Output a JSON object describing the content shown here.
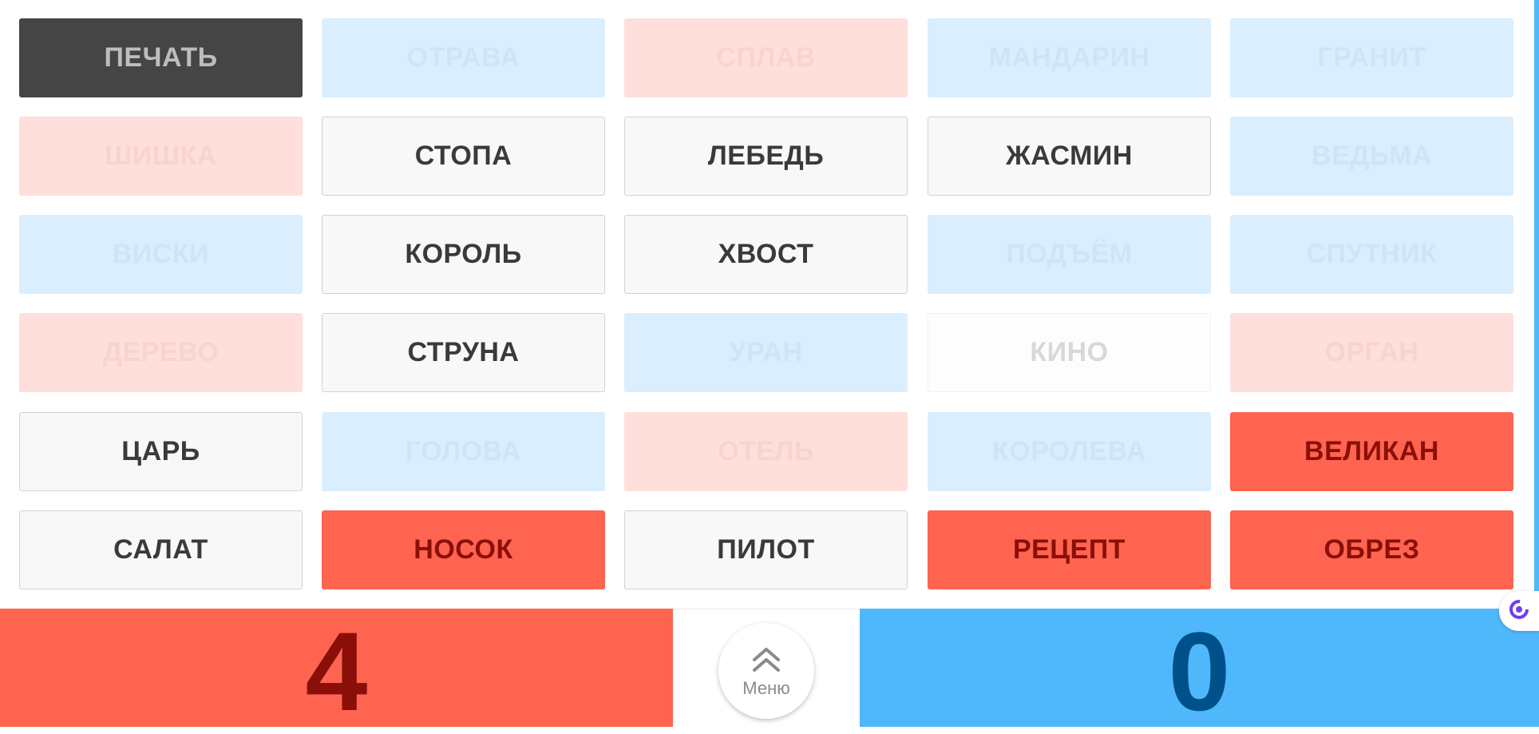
{
  "board": {
    "rows": [
      [
        {
          "word": "ПЕЧАТЬ",
          "state": "black-open"
        },
        {
          "word": "ОТРАВА",
          "state": "blue-faded"
        },
        {
          "word": "СПЛАВ",
          "state": "red-faded"
        },
        {
          "word": "МАНДАРИН",
          "state": "blue-faded"
        },
        {
          "word": "ГРАНИТ",
          "state": "blue-faded"
        }
      ],
      [
        {
          "word": "ШИШКА",
          "state": "red-faded"
        },
        {
          "word": "СТОПА",
          "state": "neutral"
        },
        {
          "word": "ЛЕБЕДЬ",
          "state": "neutral"
        },
        {
          "word": "ЖАСМИН",
          "state": "neutral"
        },
        {
          "word": "ВЕДЬМА",
          "state": "blue-faded"
        }
      ],
      [
        {
          "word": "ВИСКИ",
          "state": "blue-faded"
        },
        {
          "word": "КОРОЛЬ",
          "state": "neutral"
        },
        {
          "word": "ХВОСТ",
          "state": "neutral"
        },
        {
          "word": "ПОДЪЁМ",
          "state": "blue-faded"
        },
        {
          "word": "СПУТНИК",
          "state": "blue-faded"
        }
      ],
      [
        {
          "word": "ДЕРЕВО",
          "state": "red-faded"
        },
        {
          "word": "СТРУНА",
          "state": "neutral"
        },
        {
          "word": "УРАН",
          "state": "blue-faded"
        },
        {
          "word": "КИНО",
          "state": "neutral-faded"
        },
        {
          "word": "ОРГАН",
          "state": "red-faded"
        }
      ],
      [
        {
          "word": "ЦАРЬ",
          "state": "neutral"
        },
        {
          "word": "ГОЛОВА",
          "state": "blue-faded"
        },
        {
          "word": "ОТЕЛЬ",
          "state": "red-faded"
        },
        {
          "word": "КОРОЛЕВА",
          "state": "blue-faded"
        },
        {
          "word": "ВЕЛИКАН",
          "state": "red-open"
        }
      ],
      [
        {
          "word": "САЛАТ",
          "state": "neutral"
        },
        {
          "word": "НОСОК",
          "state": "red-open"
        },
        {
          "word": "ПИЛОТ",
          "state": "neutral"
        },
        {
          "word": "РЕЦЕПТ",
          "state": "red-open"
        },
        {
          "word": "ОБРЕЗ",
          "state": "red-open"
        }
      ]
    ]
  },
  "scores": {
    "red": "4",
    "blue": "0"
  },
  "menu": {
    "label": "Меню",
    "icon": "double-chevron-up-icon"
  },
  "colors": {
    "red_team": "#fe6450",
    "blue_team": "#4fb8fb",
    "black_card": "#454545",
    "neutral_card": "#f8f8f8"
  }
}
